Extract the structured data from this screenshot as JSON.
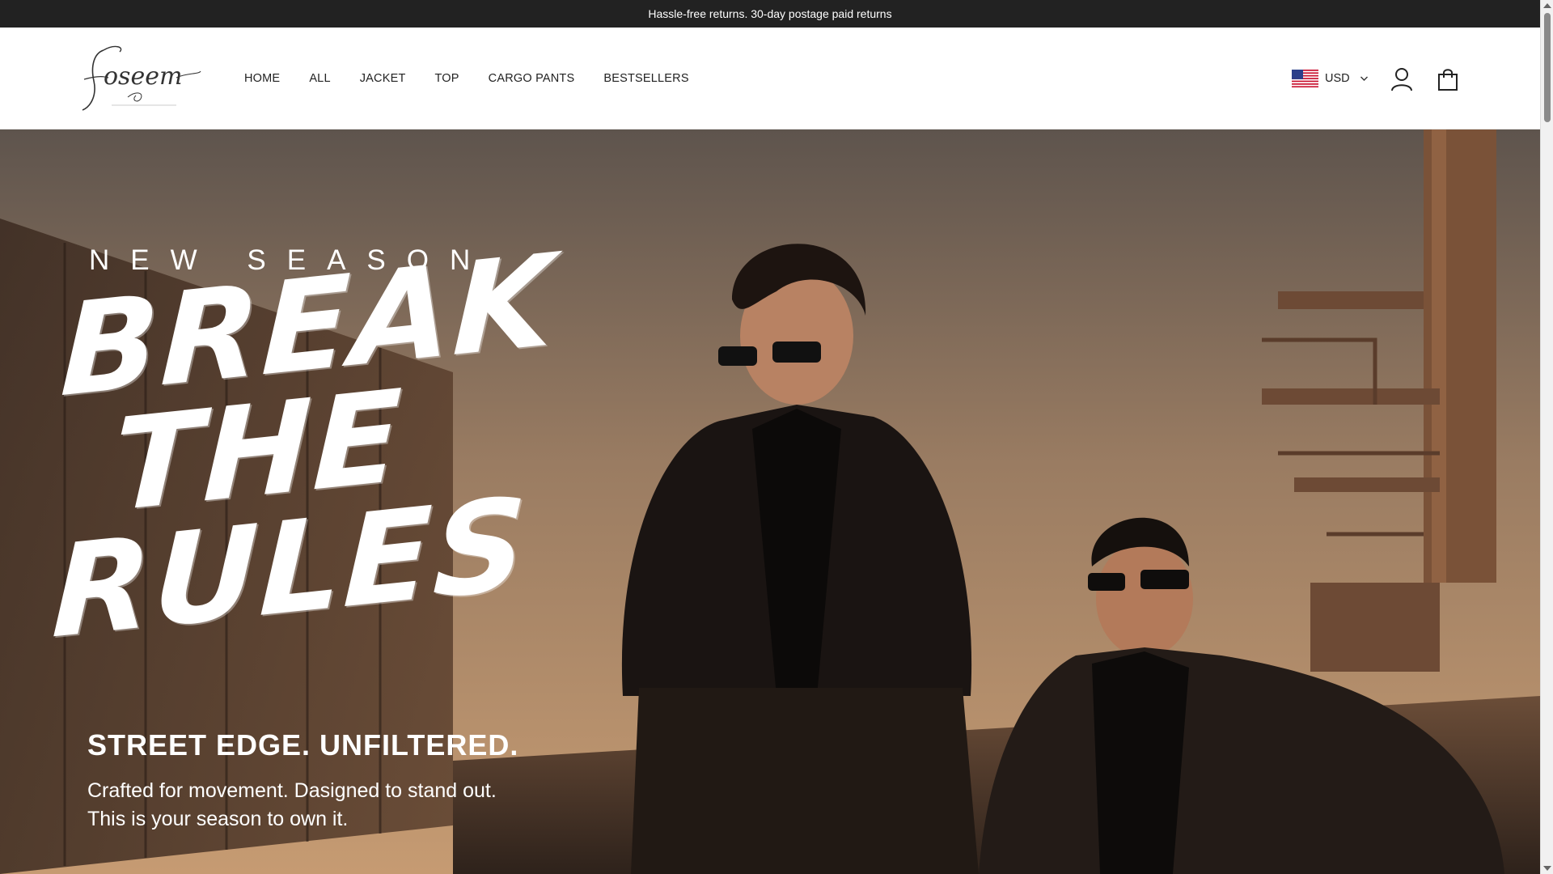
{
  "announcement": {
    "text": "Hassle-free returns. 30-day postage paid returns"
  },
  "header": {
    "logo_text": "foseem",
    "nav": [
      {
        "label": "HOME"
      },
      {
        "label": "ALL"
      },
      {
        "label": "JACKET"
      },
      {
        "label": "TOP"
      },
      {
        "label": "CARGO PANTS"
      },
      {
        "label": "BESTSELLERS"
      }
    ],
    "currency": {
      "label": "USD",
      "flag_icon": "us-flag-icon"
    },
    "account_icon": "user-icon",
    "cart_icon": "shopping-bag-icon"
  },
  "hero": {
    "eyebrow": "NEW SEASON",
    "headline": [
      "BREAK",
      "THE",
      "RULES"
    ],
    "tagline": "STREET EDGE. UNFILTERED.",
    "subcopy_line1": "Crafted for movement. Dasigned to stand out.",
    "subcopy_line2": "This is your season to own it."
  },
  "colors": {
    "announcement_bg": "#222222",
    "text_dark": "#222222",
    "hero_text": "#ffffff"
  }
}
